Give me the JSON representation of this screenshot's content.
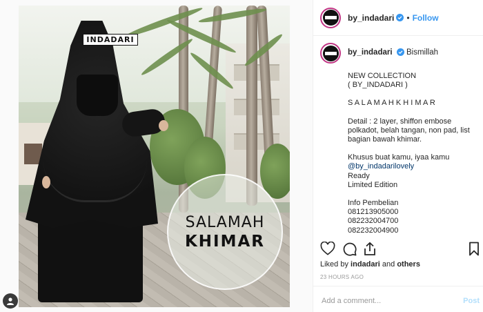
{
  "post": {
    "brand_tag": "INDADARI",
    "badge_line1": "SALAMAH",
    "badge_line2": "KHIMAR"
  },
  "header": {
    "username": "by_indadari",
    "separator": "•",
    "follow_label": "Follow"
  },
  "caption": {
    "username": "by_indadari",
    "first_line": "Bismillah",
    "lines": [
      "NEW COLLECTION",
      "( BY_INDADARI )",
      "",
      "S A L A M A H K H I M A R",
      "",
      "Detail : 2 layer, shiffon embose",
      "polkadot, belah tangan, non pad, list",
      "bagian bawah khimar.",
      "",
      "Khusus buat kamu, iyaa kamu"
    ],
    "mention": "@by_indadarilovely",
    "lines_after": [
      "Ready",
      "Limited Edition",
      "",
      "Info Pembelian",
      "081213905000",
      "082232004700",
      "082232004900"
    ]
  },
  "likes": {
    "prefix": "Liked by",
    "user": "indadari",
    "connector": "and",
    "others": "others"
  },
  "timestamp": "23 HOURS AGO",
  "comment": {
    "placeholder": "Add a comment...",
    "post_label": "Post"
  },
  "colors": {
    "link_blue": "#3897f0",
    "post_disabled": "#b2dffc",
    "mention": "#003569",
    "story_ring": "#c13584"
  }
}
